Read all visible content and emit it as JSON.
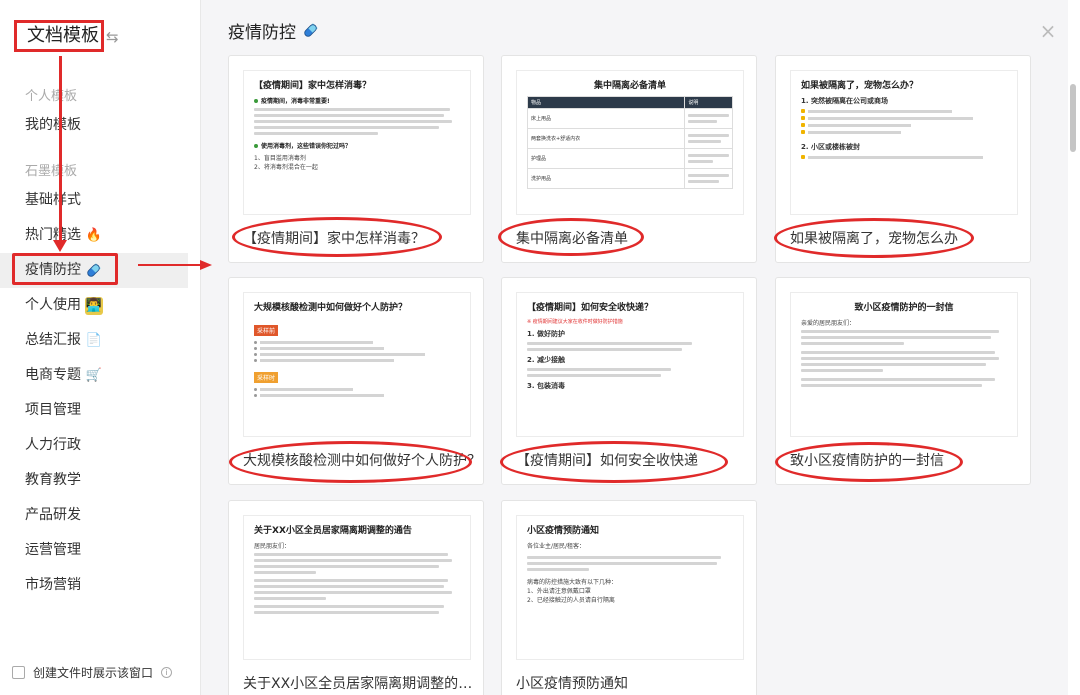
{
  "sidebar": {
    "title": "文档模板",
    "sections": [
      {
        "label": "个人模板",
        "items": [
          {
            "label": "我的模板",
            "emoji": ""
          }
        ]
      },
      {
        "label": "石墨模板",
        "items": [
          {
            "label": "基础样式",
            "emoji": ""
          },
          {
            "label": "热门精选",
            "emoji": "🔥"
          },
          {
            "label": "疫情防控",
            "emoji": "💊"
          },
          {
            "label": "个人使用",
            "emoji": "👨‍💻"
          },
          {
            "label": "总结汇报",
            "emoji": "📄"
          },
          {
            "label": "电商专题",
            "emoji": "🛒"
          },
          {
            "label": "项目管理",
            "emoji": ""
          },
          {
            "label": "人力行政",
            "emoji": ""
          },
          {
            "label": "教育教学",
            "emoji": ""
          },
          {
            "label": "产品研发",
            "emoji": ""
          },
          {
            "label": "运营管理",
            "emoji": ""
          },
          {
            "label": "市场营销",
            "emoji": ""
          }
        ]
      }
    ],
    "active_item": "疫情防控",
    "footer_checkbox_label": "创建文件时展示该窗口",
    "footer_info_icon": "ⓘ"
  },
  "main": {
    "title": "疫情防控",
    "title_icon": "pill-icon",
    "close_icon": "×",
    "cards": [
      {
        "label": "【疫情期间】家中怎样消毒？",
        "doc": {
          "title": "【疫情期间】家中怎样消毒？",
          "sub1": "疫情期间，消毒非常重要!",
          "sub2": "使用消毒剂，这些错误你犯过吗？",
          "items": [
            "1、盲目滥用消毒剂",
            "2、将消毒剂混合在一起"
          ]
        }
      },
      {
        "label": "集中隔离必备清单",
        "doc": {
          "title": "集中隔离必备清单",
          "headers": [
            "物品",
            "说明"
          ],
          "rows": [
            "床上用品",
            "两套换洗衣+舒适内衣",
            "护理品",
            "洗护用品"
          ]
        }
      },
      {
        "label": "如果被隔离了，宠物怎么办",
        "doc": {
          "title": "如果被隔离了，宠物怎么办？",
          "sub1": "1. 突然被隔离在公司或商场",
          "sub2": "2. 小区或楼栋被封"
        }
      },
      {
        "label": "大规模核酸检测中如何做好个人防护？",
        "doc": {
          "title": "大规模核酸检测中如何做好个人防护？",
          "tag1": "采样前",
          "tag2": "采样时"
        }
      },
      {
        "label": "【疫情期间】如何安全收快递",
        "doc": {
          "title": "【疫情期间】如何安全收快递？",
          "notice": "※ 疫情期间建议大家在收件时做好防护措施",
          "sub1": "1. 做好防护",
          "sub2": "2. 减少接触",
          "sub3": "3. 包装消毒"
        }
      },
      {
        "label": "致小区疫情防护的一封信",
        "doc": {
          "title": "致小区疫情防护的一封信",
          "greeting": "亲爱的居民朋友们："
        }
      },
      {
        "label": "关于XX小区全员居家隔离期调整的通告",
        "doc": {
          "title": "关于XX小区全员居家隔离期调整的通告",
          "greeting": "居民朋友们："
        }
      },
      {
        "label": "小区疫情预防通知",
        "doc": {
          "title": "小区疫情预防通知",
          "greeting": "各位业主/居民/租客：",
          "sub1": "病毒的防控措施大致有以下几种：",
          "items": [
            "1、外出请注意佩戴口罩",
            "2、已经接触过的人员请自行隔离"
          ]
        }
      }
    ]
  },
  "colors": {
    "annotation_red": "#e02a2a",
    "active_bg": "#efefef"
  }
}
